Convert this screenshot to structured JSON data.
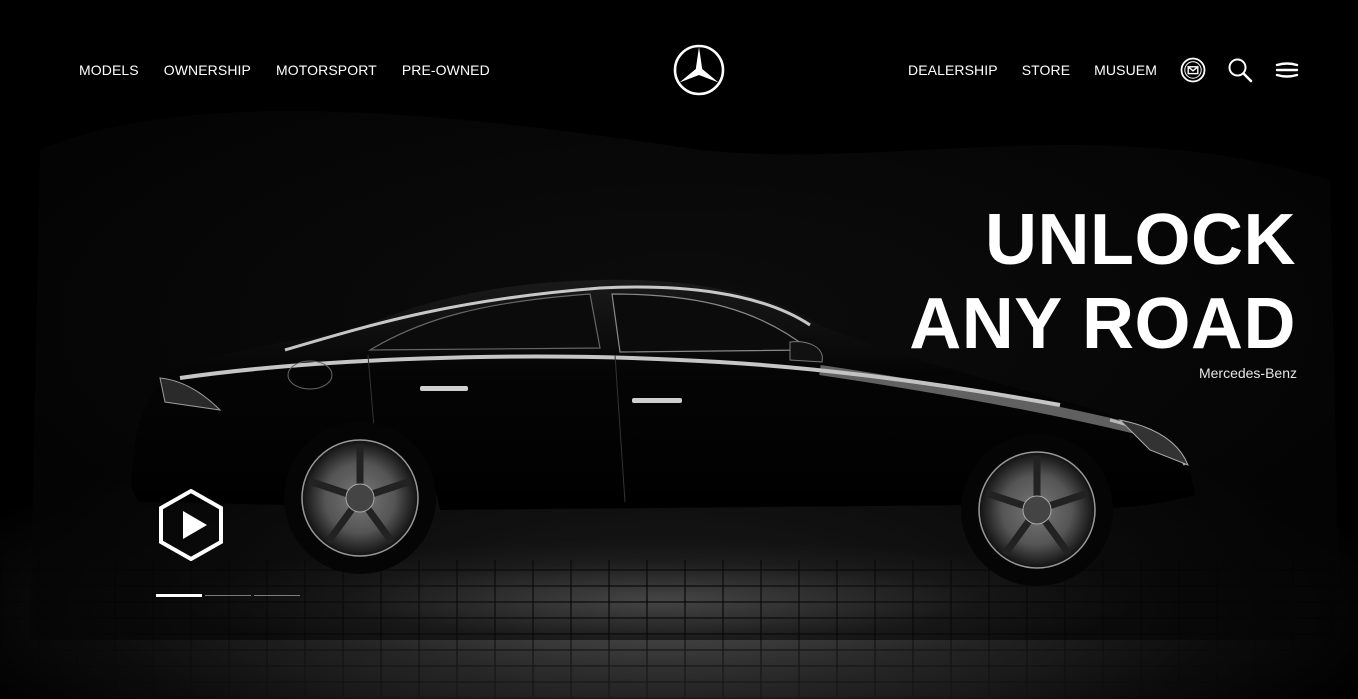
{
  "header": {
    "nav_left": [
      "MODELS",
      "OWNERSHIP",
      "MOTORSPORT",
      "PRE-OWNED"
    ],
    "nav_right": [
      "DEALERSHIP",
      "STORE",
      "MUSUEM"
    ],
    "icons": [
      "mercedes-star-logo",
      "mail-icon",
      "search-icon",
      "menu-icon"
    ]
  },
  "hero": {
    "headline_line1": "UNLOCK",
    "headline_line2": "ANY ROAD",
    "caption": "Mercedes-Benz",
    "play_icon": "play-icon",
    "slides": {
      "count": 3,
      "active_index": 0
    }
  },
  "colors": {
    "background": "#000000",
    "text": "#ffffff"
  }
}
